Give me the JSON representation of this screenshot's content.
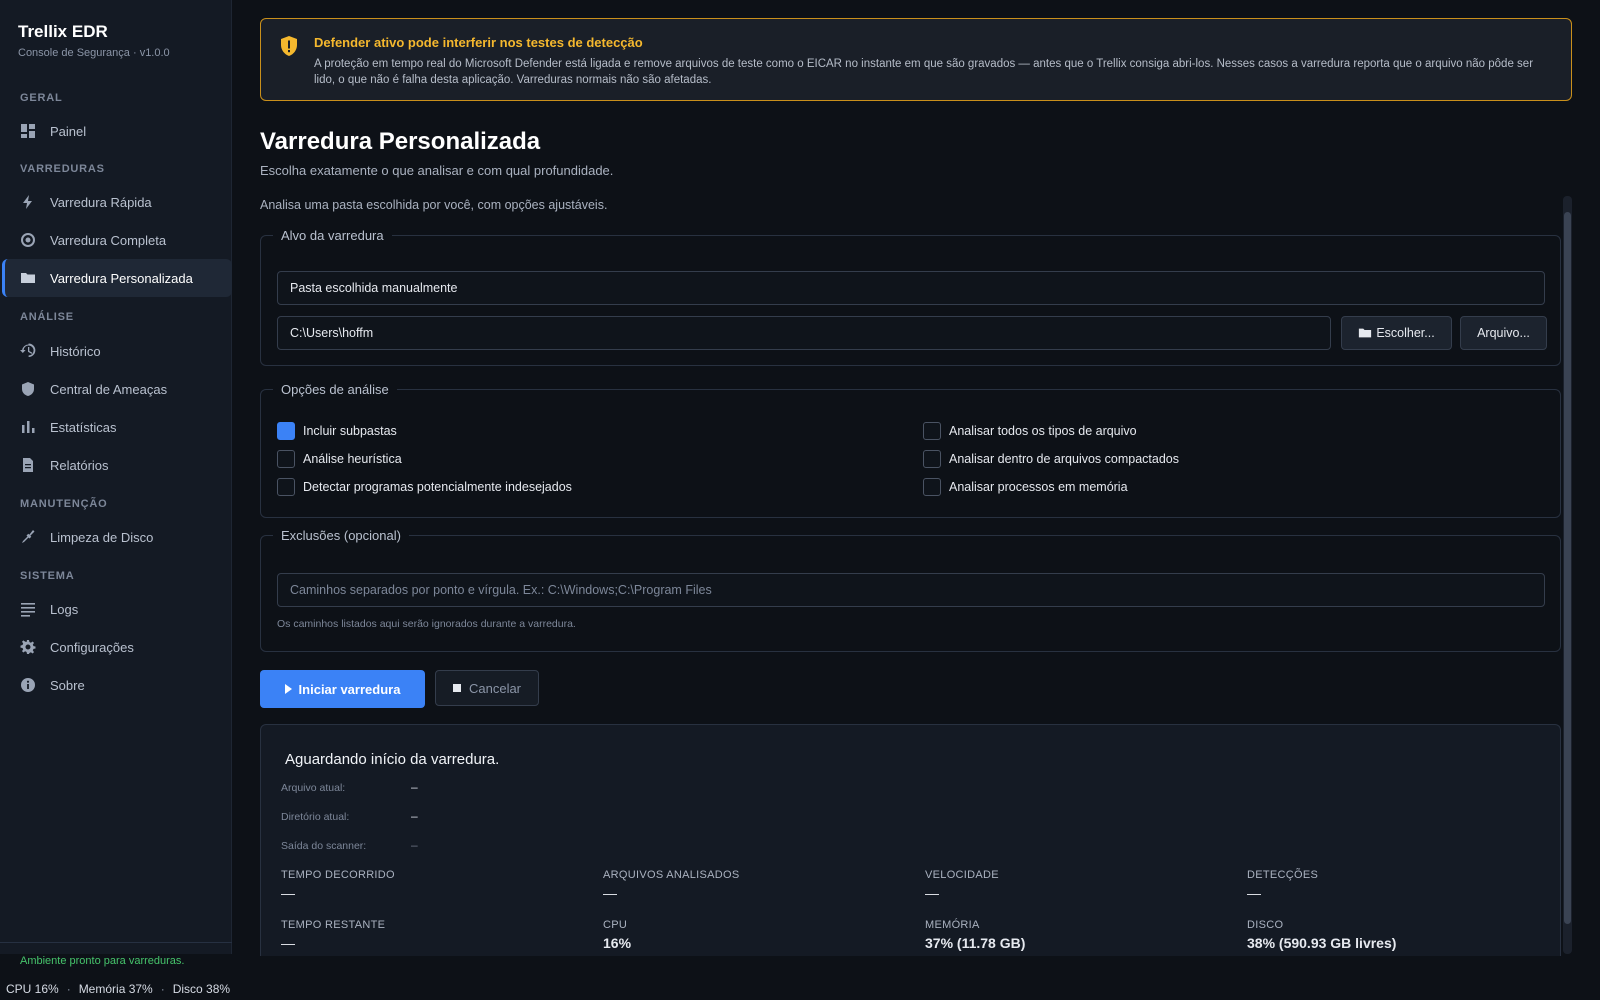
{
  "app": {
    "title": "Trellix EDR",
    "subtitle": "Console de Segurança · v1.0.0"
  },
  "sidebar": {
    "sections": {
      "geral": "GERAL",
      "varreduras": "VARREDURAS",
      "analise": "ANÁLISE",
      "manutencao": "MANUTENÇÃO",
      "sistema": "SISTEMA"
    },
    "items": {
      "painel": "Painel",
      "rapida": "Varredura Rápida",
      "completa": "Varredura Completa",
      "personalizada": "Varredura Personalizada",
      "historico": "Histórico",
      "ameacas": "Central de Ameaças",
      "estatisticas": "Estatísticas",
      "relatorios": "Relatórios",
      "limpeza": "Limpeza de Disco",
      "logs": "Logs",
      "config": "Configurações",
      "sobre": "Sobre"
    },
    "active_item": "Varredura Personalizada",
    "status": "Ambiente pronto para varreduras."
  },
  "statusbar": {
    "cpu": "CPU 16%",
    "mem": "Memória 37%",
    "disk": "Disco 38%",
    "sep": "·"
  },
  "alert": {
    "title": "Defender ativo pode interferir nos testes de detecção",
    "text": "A proteção em tempo real do Microsoft Defender está ligada e remove arquivos de teste como o EICAR no instante em que são gravados — antes que o Trellix consiga abri-los. Nesses casos a varredura reporta que o arquivo não pôde ser lido, o que não é falha desta aplicação. Varreduras normais não são afetadas."
  },
  "page": {
    "title": "Varredura Personalizada",
    "subtitle": "Escolha exatamente o que analisar e com qual profundidade.",
    "description": "Analisa uma pasta escolhida por você, com opções ajustáveis."
  },
  "target": {
    "legend": "Alvo da varredura",
    "mode": "Pasta escolhida manualmente",
    "path": "C:\\Users\\hoffm",
    "choose_folder": "Escolher...",
    "choose_file": "Arquivo..."
  },
  "options": {
    "legend": "Opções de análise",
    "items": [
      {
        "label": "Incluir subpastas",
        "checked": true
      },
      {
        "label": "Análise heurística",
        "checked": false
      },
      {
        "label": "Detectar programas potencialmente indesejados",
        "checked": false
      },
      {
        "label": "Analisar todos os tipos de arquivo",
        "checked": false
      },
      {
        "label": "Analisar dentro de arquivos compactados",
        "checked": false
      },
      {
        "label": "Analisar processos em memória",
        "checked": false
      }
    ]
  },
  "exclusions": {
    "legend": "Exclusões (opcional)",
    "placeholder": "Caminhos separados por ponto e vírgula. Ex.: C:\\Windows;C:\\Program Files",
    "hint": "Os caminhos listados aqui serão ignorados durante a varredura."
  },
  "actions": {
    "start": "Iniciar varredura",
    "cancel": "Cancelar"
  },
  "progress": {
    "title": "Aguardando início da varredura.",
    "current_file_label": "Arquivo atual:",
    "current_file": "–",
    "current_dir_label": "Diretório atual:",
    "current_dir": "–",
    "scanner_output_label": "Saída do scanner:",
    "scanner_output": "–",
    "stats": [
      {
        "label": "TEMPO DECORRIDO",
        "value": "—"
      },
      {
        "label": "ARQUIVOS ANALISADOS",
        "value": "—"
      },
      {
        "label": "VELOCIDADE",
        "value": "—"
      },
      {
        "label": "DETECÇÕES",
        "value": "—"
      },
      {
        "label": "TEMPO RESTANTE",
        "value": "—"
      },
      {
        "label": "CPU",
        "value": "16%"
      },
      {
        "label": "MEMÓRIA",
        "value": "37% (11.78 GB)"
      },
      {
        "label": "DISCO",
        "value": "38% (590.93 GB livres)"
      }
    ]
  },
  "colors": {
    "accent": "#3b82f6",
    "warning": "#f5b82e",
    "ok": "#46c46b",
    "background": "#0d1117",
    "sidebar": "#141a24"
  },
  "icons": {
    "painel": "grid-icon",
    "rapida": "bolt-icon",
    "completa": "target-icon",
    "personalizada": "folder-icon",
    "historico": "history-icon",
    "ameacas": "shield-icon",
    "estatisticas": "bar-chart-icon",
    "relatorios": "document-icon",
    "limpeza": "broom-icon",
    "logs": "list-icon",
    "config": "gear-icon",
    "sobre": "info-icon",
    "alert": "shield-warning-icon"
  }
}
